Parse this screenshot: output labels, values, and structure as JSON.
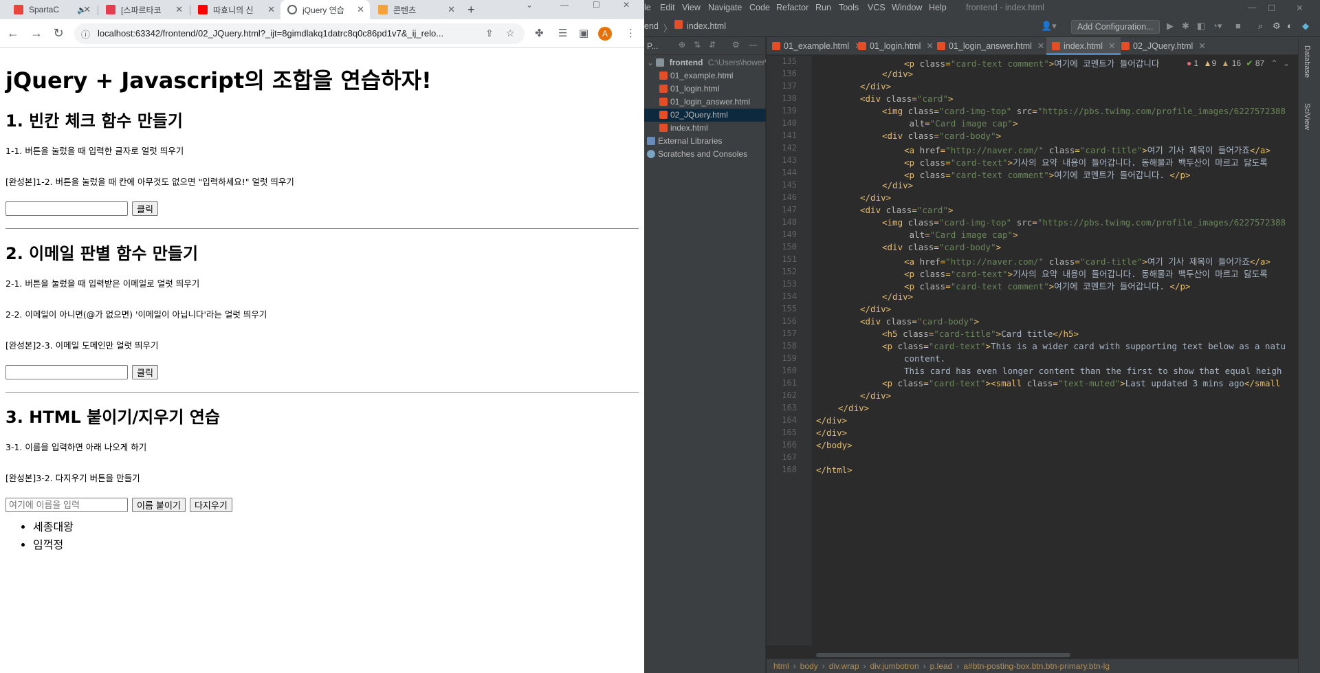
{
  "browser": {
    "tabs": [
      {
        "label": "SpartaC",
        "color": "#e8453c"
      },
      {
        "label": "[스파르타코",
        "color": "#e43d4f"
      },
      {
        "label": "따효니의 신",
        "color": "#ff0000"
      },
      {
        "label": "jQuery 연습",
        "color": "#5f6368"
      },
      {
        "label": "콘텐츠",
        "color": "#f2a33a"
      }
    ],
    "url": "localhost:63342/frontend/02_JQuery.html?_ijt=8gimdlakq1datrc8q0c86pd1v7&_ij_relo...",
    "profile_initial": "A"
  },
  "page": {
    "title": "jQuery + Javascript의 조합을 연습하자!",
    "section1": {
      "heading": "1. 빈칸 체크 함수 만들기",
      "task1": "1-1. 버튼을 눌렀을 때 입력한 글자로 얼럿 띄우기",
      "task2": "[완성본]1-2. 버튼을 눌렀을 때 칸에 아무것도 없으면 \"입력하세요!\" 얼럿 띄우기",
      "input_value": "",
      "button": "클릭"
    },
    "section2": {
      "heading": "2. 이메일 판별 함수 만들기",
      "task1": "2-1. 버튼을 눌렀을 때 입력받은 이메일로 얼럿 띄우기",
      "task2": "2-2. 이메일이 아니면(@가 없으면) '이메일이 아닙니다'라는 얼럿 띄우기",
      "task3": "[완성본]2-3. 이메일 도메인만 얼럿 띄우기",
      "input_value": "",
      "button": "클릭"
    },
    "section3": {
      "heading": "3. HTML 붙이기/지우기 연습",
      "task1": "3-1. 이름을 입력하면 아래 나오게 하기",
      "task2": "[완성본]3-2. 다지우기 버튼을 만들기",
      "input_placeholder": "여기에 이름을 입력",
      "append_button": "이름 붙이기",
      "clear_button": "다지우기",
      "names": [
        "세종대왕",
        "임꺽정"
      ]
    }
  },
  "ide": {
    "menu": [
      "le",
      "Edit",
      "View",
      "Navigate",
      "Code",
      "Refactor",
      "Run",
      "Tools",
      "VCS",
      "Window",
      "Help"
    ],
    "title": "frontend - index.html",
    "breadcrumb_project": "end",
    "breadcrumb_file": "index.html",
    "add_config": "Add Configuration...",
    "project_label": "P...",
    "tree": {
      "root": "frontend",
      "root_path": "C:\\Users\\hower\\",
      "files": [
        "01_example.html",
        "01_login.html",
        "01_login_answer.html",
        "02_JQuery.html",
        "index.html"
      ],
      "selected": "02_JQuery.html",
      "external": "External Libraries",
      "scratches": "Scratches and Consoles"
    },
    "editor_tabs": [
      "01_example.html",
      "01_login.html",
      "01_login_answer.html",
      "index.html",
      "02_JQuery.html"
    ],
    "active_tab": "index.html",
    "inspections": {
      "errors": "1",
      "warnings": "9",
      "weak": "16",
      "ok": "87"
    },
    "right_tools": [
      "Database",
      "SciView"
    ],
    "status_path": [
      "html",
      "body",
      "div.wrap",
      "div.jumbotron",
      "p.lead",
      "a#btn-posting-box.btn.btn-primary.btn-lg"
    ],
    "code_lines": [
      {
        "n": "135",
        "i": 4,
        "html": "<span class='tag'>&lt;p </span><span class='attr'>class</span><span class='tag'>=</span><span class='str'>\"card-text comment\"</span><span class='tag'>&gt;</span>여기에 코멘트가 들어갑니다"
      },
      {
        "n": "136",
        "i": 3,
        "html": "<span class='tag'>&lt;/div&gt;</span>"
      },
      {
        "n": "137",
        "i": 2,
        "html": "<span class='tag'>&lt;/div&gt;</span>"
      },
      {
        "n": "138",
        "i": 2,
        "html": "<span class='tag'>&lt;div </span><span class='attr'>class</span><span class='tag'>=</span><span class='str'>\"card\"</span><span class='tag'>&gt;</span>"
      },
      {
        "n": "139",
        "i": 3,
        "html": "<span class='tag'>&lt;img </span><span class='attr'>class</span><span class='tag'>=</span><span class='str'>\"card-img-top\"</span> <span class='attr'>src</span><span class='tag'>=</span><span class='str'>\"https://pbs.twimg.com/profile_images/6227572388</span>"
      },
      {
        "n": "140",
        "i": 4,
        "html": " <span class='attr'>alt</span><span class='tag'>=</span><span class='str'>\"Card image cap\"</span><span class='tag'>&gt;</span>"
      },
      {
        "n": "141",
        "i": 3,
        "html": "<span class='tag'>&lt;div </span><span class='attr'>class</span><span class='tag'>=</span><span class='str'>\"card-body\"</span><span class='tag'>&gt;</span>"
      },
      {
        "n": "142",
        "i": 4,
        "html": "<span class='tag'>&lt;a </span><span class='attr'>href</span><span class='tag'>=</span><span class='str'>\"http://naver.com/\"</span> <span class='attr'>class</span><span class='tag'>=</span><span class='str'>\"card-title\"</span><span class='tag'>&gt;</span>여기 기사 제목이 들어가죠<span class='tag'>&lt;/a&gt;</span>"
      },
      {
        "n": "143",
        "i": 4,
        "html": "<span class='tag'>&lt;p </span><span class='attr'>class</span><span class='tag'>=</span><span class='str'>\"card-text\"</span><span class='tag'>&gt;</span>기사의 요약 내용이 들어갑니다. 동해물과 백두산이 마르고 닳도록"
      },
      {
        "n": "144",
        "i": 4,
        "html": "<span class='tag'>&lt;p </span><span class='attr'>class</span><span class='tag'>=</span><span class='str'>\"card-text comment\"</span><span class='tag'>&gt;</span>여기에 코멘트가 들어갑니다. <span class='tag'>&lt;/p&gt;</span>"
      },
      {
        "n": "145",
        "i": 3,
        "html": "<span class='tag'>&lt;/div&gt;</span>"
      },
      {
        "n": "146",
        "i": 2,
        "html": "<span class='tag'>&lt;/div&gt;</span>"
      },
      {
        "n": "147",
        "i": 2,
        "html": "<span class='tag'>&lt;div </span><span class='attr'>class</span><span class='tag'>=</span><span class='str'>\"card\"</span><span class='tag'>&gt;</span>"
      },
      {
        "n": "148",
        "i": 3,
        "html": "<span class='tag'>&lt;img </span><span class='attr'>class</span><span class='tag'>=</span><span class='str'>\"card-img-top\"</span> <span class='attr'>src</span><span class='tag'>=</span><span class='str'>\"https://pbs.twimg.com/profile_images/6227572388</span>"
      },
      {
        "n": "149",
        "i": 4,
        "html": " <span class='attr'>alt</span><span class='tag'>=</span><span class='str'>\"Card image cap\"</span><span class='tag'>&gt;</span>"
      },
      {
        "n": "150",
        "i": 3,
        "html": "<span class='tag'>&lt;div </span><span class='attr'>class</span><span class='tag'>=</span><span class='str'>\"card-body\"</span><span class='tag'>&gt;</span>"
      },
      {
        "n": "151",
        "i": 4,
        "html": "<span class='tag'>&lt;a </span><span class='attr'>href</span><span class='tag'>=</span><span class='str'>\"http://naver.com/\"</span> <span class='attr'>class</span><span class='tag'>=</span><span class='str'>\"card-title\"</span><span class='tag'>&gt;</span>여기 기사 제목이 들어가죠<span class='tag'>&lt;/a&gt;</span>"
      },
      {
        "n": "152",
        "i": 4,
        "html": "<span class='tag'>&lt;p </span><span class='attr'>class</span><span class='tag'>=</span><span class='str'>\"card-text\"</span><span class='tag'>&gt;</span>기사의 요약 내용이 들어갑니다. 동해물과 백두산이 마르고 닳도록"
      },
      {
        "n": "153",
        "i": 4,
        "html": "<span class='tag'>&lt;p </span><span class='attr'>class</span><span class='tag'>=</span><span class='str'>\"card-text comment\"</span><span class='tag'>&gt;</span>여기에 코멘트가 들어갑니다. <span class='tag'>&lt;/p&gt;</span>"
      },
      {
        "n": "154",
        "i": 3,
        "html": "<span class='tag'>&lt;/div&gt;</span>"
      },
      {
        "n": "155",
        "i": 2,
        "html": "<span class='tag'>&lt;/div&gt;</span>"
      },
      {
        "n": "156",
        "i": 2,
        "html": "<span class='tag'>&lt;div </span><span class='attr'>class</span><span class='tag'>=</span><span class='str'>\"card-body\"</span><span class='tag'>&gt;</span>"
      },
      {
        "n": "157",
        "i": 3,
        "html": "<span class='tag'>&lt;h5 </span><span class='attr'>class</span><span class='tag'>=</span><span class='str'>\"card-title\"</span><span class='tag'>&gt;</span>Card title<span class='tag'>&lt;/h5&gt;</span>"
      },
      {
        "n": "158",
        "i": 3,
        "html": "<span class='tag'>&lt;p </span><span class='attr'>class</span><span class='tag'>=</span><span class='str'>\"card-text\"</span><span class='tag'>&gt;</span>This is a wider card with supporting text below as a natu"
      },
      {
        "n": "159",
        "i": 4,
        "html": "content."
      },
      {
        "n": "160",
        "i": 4,
        "html": "This card has even longer content than the first to show that equal heigh"
      },
      {
        "n": "161",
        "i": 3,
        "html": "<span class='tag'>&lt;p </span><span class='attr'>class</span><span class='tag'>=</span><span class='str'>\"card-text\"</span><span class='tag'>&gt;&lt;small </span><span class='attr'>class</span><span class='tag'>=</span><span class='str'>\"text-muted\"</span><span class='tag'>&gt;</span>Last updated 3 mins ago<span class='tag'>&lt;/small</span>"
      },
      {
        "n": "162",
        "i": 2,
        "html": "<span class='tag'>&lt;/div&gt;</span>"
      },
      {
        "n": "163",
        "i": 1,
        "html": "<span class='tag'>&lt;/div&gt;</span>"
      },
      {
        "n": "164",
        "i": 0,
        "html": "<span class='tag'>&lt;/div&gt;</span>"
      },
      {
        "n": "165",
        "i": 0,
        "html": "<span class='tag'>&lt;/div&gt;</span>"
      },
      {
        "n": "166",
        "i": 0,
        "html": "<span class='tag'>&lt;/body&gt;</span>"
      },
      {
        "n": "167",
        "i": 0,
        "html": ""
      },
      {
        "n": "168",
        "i": 0,
        "html": "<span class='tag'>&lt;/html&gt;</span>"
      }
    ]
  }
}
